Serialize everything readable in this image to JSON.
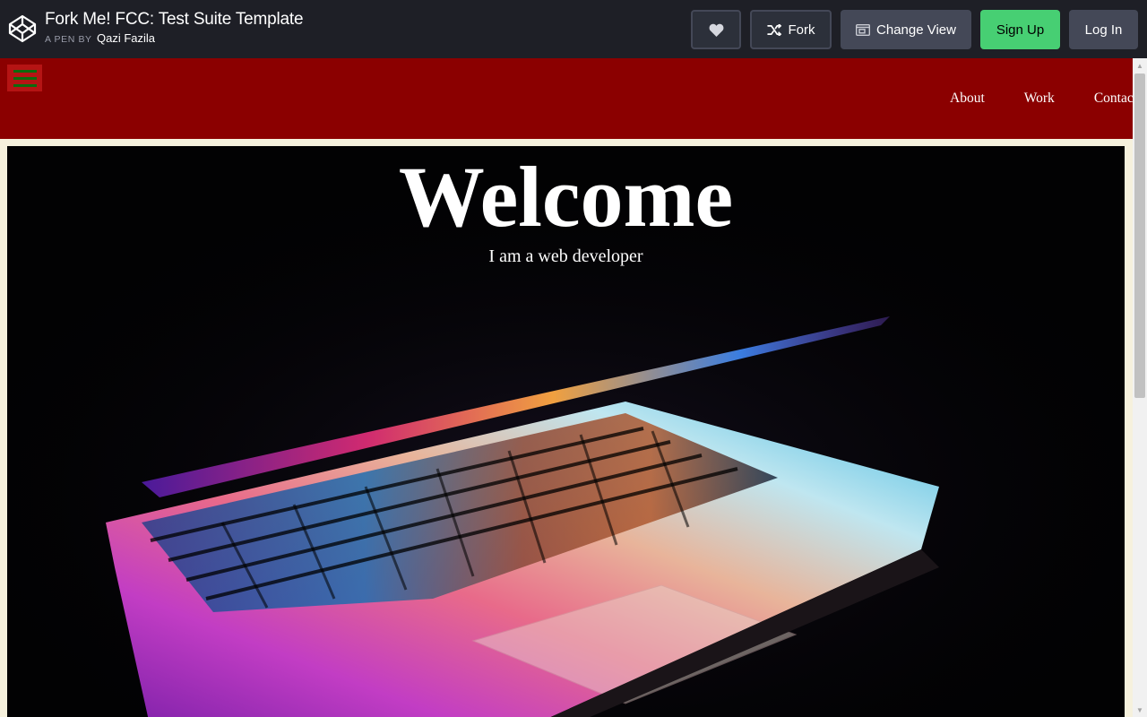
{
  "codepen_header": {
    "pen_title": "Fork Me! FCC: Test Suite Template",
    "byline_prefix": "A PEN BY",
    "author": "Qazi Fazila",
    "buttons": {
      "heart_icon": "heart-icon",
      "fork_label": "Fork",
      "fork_icon": "fork-icon",
      "change_view_label": "Change View",
      "change_view_icon": "window-icon",
      "sign_up_label": "Sign Up",
      "log_in_label": "Log In"
    },
    "colors": {
      "bar": "#1e1f26",
      "sign_up": "#47cf73",
      "button": "#444857"
    }
  },
  "site": {
    "nav": {
      "menu_icon": "hamburger-icon",
      "links": [
        "About",
        "Work",
        "Contact"
      ],
      "background": "#8b0000"
    },
    "hero": {
      "title": "Welcome",
      "subtitle": "I am a web developer",
      "image_description": "glowing-laptop-keyboard"
    },
    "page_background": "#f6f1dd"
  }
}
